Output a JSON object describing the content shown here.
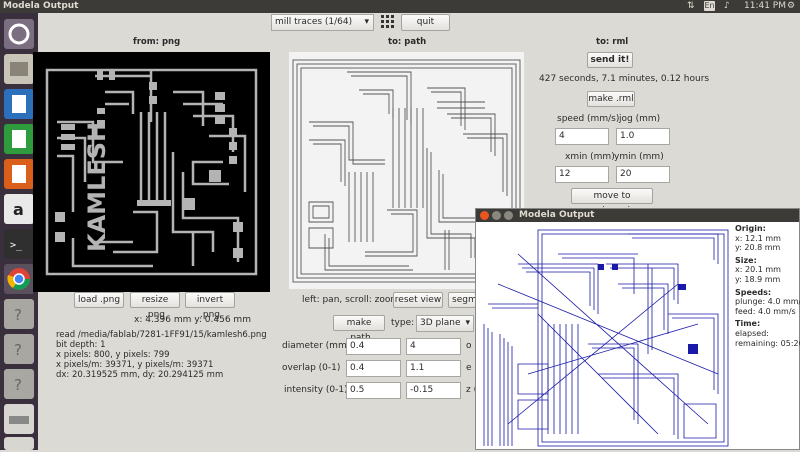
{
  "topbar": {
    "title": "Modela Output",
    "lang": "En",
    "time": "11:41 PM"
  },
  "launcher": {
    "items": [
      "ubuntu-icon",
      "files-icon",
      "writer-icon",
      "calc-icon",
      "impress-icon",
      "amazon-icon",
      "terminal-icon",
      "chrome-icon",
      "unknown-app-icon",
      "unknown-app-icon",
      "unknown-app-icon",
      "drive-icon",
      "trash-icon"
    ]
  },
  "toolbar": {
    "mode_value": "mill traces (1/64)",
    "quit_label": "quit"
  },
  "from_png": {
    "header": "from: png",
    "load_label": "load .png",
    "resize_label": "resize .png",
    "invert_label": "invert .png",
    "coords": "x: 4.396 mm  y: 0.456 mm",
    "board_text": "KAMLESH",
    "info": [
      "read /media/fablab/7281-1FF91/15/kamlesh6.png",
      "  bit depth: 1",
      "  x pixels: 800, y pixels: 799",
      "  x pixels/m: 39371, y pixels/m: 39371",
      "  dx: 20.319525 mm, dy: 20.294125 mm"
    ]
  },
  "to_path": {
    "header": "to: path",
    "hint": "left: pan, scroll: zoom",
    "reset_label": "reset view",
    "segment_label": "segm",
    "make_path_label": "make .path",
    "type_label": "type:",
    "type_value": "3D plane",
    "diameter_label": "diameter (mm)",
    "diameter_value": "0.4",
    "diameter_value2": "4",
    "overlap_label": "overlap (0-1)",
    "overlap_value": "0.4",
    "overlap_value2": "1.1",
    "intensity_label": "intensity (0-1)",
    "intensity_value": "0.5",
    "intensity_value2": "-0.15",
    "right_col_o": "o",
    "right_col_e": "e",
    "right_col_z": "z ("
  },
  "to_rml": {
    "header": "to: rml",
    "send_label": "send it!",
    "estimate": "427 seconds, 7.1 minutes, 0.12 hours",
    "make_rml_label": "make .rml",
    "speed_label": "speed (mm/s)",
    "speed_value": "4",
    "jog_label": "jog (mm)",
    "jog_value": "1.0",
    "xmin_label": "xmin (mm)",
    "xmin_value": "12",
    "ymin_label": "ymin (mm)",
    "ymin_value": "20",
    "move_label": "move to xmin,ymin"
  },
  "popup": {
    "title": "Modela Output",
    "origin_h": "Origin:",
    "origin_x": "x: 12.1 mm",
    "origin_y": "y: 20.8 mm",
    "size_h": "Size:",
    "size_x": "x: 20.1 mm",
    "size_y": "y: 18.9 mm",
    "speeds_h": "Speeds:",
    "plunge": "plunge: 4.0 mm/s",
    "feed": "feed: 4.0 mm/s",
    "time_h": "Time:",
    "elapsed": "elapsed:",
    "remaining": "remaining: 05:26"
  },
  "colors": {
    "accent_orange": "#e95420",
    "toolpath_blue": "#1a1aa8",
    "trace_gray": "#b4b4b4"
  }
}
